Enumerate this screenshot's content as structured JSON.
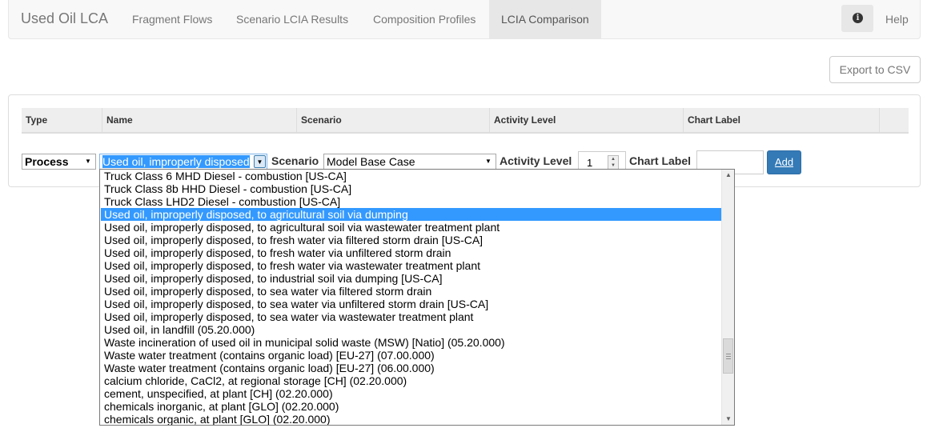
{
  "navbar": {
    "brand": "Used Oil LCA",
    "items": [
      {
        "label": "Fragment Flows"
      },
      {
        "label": "Scenario LCIA Results"
      },
      {
        "label": "Composition Profiles"
      },
      {
        "label": "LCIA Comparison",
        "active": true
      }
    ],
    "info_icon": "info-circle",
    "help_label": "Help"
  },
  "toolbar": {
    "export_label": "Export to CSV"
  },
  "table": {
    "headers": [
      "Type",
      "Name",
      "Scenario",
      "Activity Level",
      "Chart Label"
    ]
  },
  "form": {
    "type_value": "Process",
    "name_value": "Used oil, improperly disposed",
    "scenario_label": "Scenario",
    "scenario_value": "Model Base Case",
    "activity_label": "Activity Level",
    "activity_value": "1",
    "chart_label": "Chart Label",
    "chart_label_value": "",
    "add_label": "Add"
  },
  "dropdown": {
    "highlighted_index": 3,
    "options": [
      "Truck Class 6 MHD Diesel - combustion [US-CA]",
      "Truck Class 8b HHD Diesel - combustion [US-CA]",
      "Truck Class LHD2 Diesel - combustion [US-CA]",
      "Used oil, improperly disposed, to agricultural soil via dumping",
      "Used oil, improperly disposed, to agricultural soil via wastewater treatment plant",
      "Used oil, improperly disposed, to fresh water via filtered storm drain [US-CA]",
      "Used oil, improperly disposed, to fresh water via unfiltered storm drain",
      "Used oil, improperly disposed, to fresh water via wastewater treatment plant",
      "Used oil, improperly disposed, to industrial soil via dumping [US-CA]",
      "Used oil, improperly disposed, to sea water via filtered storm drain",
      "Used oil, improperly disposed, to sea water via unfiltered storm drain [US-CA]",
      "Used oil, improperly disposed, to sea water via wastewater treatment plant",
      "Used oil, in landfill (05.20.000)",
      "Waste incineration of used oil in municipal solid waste (MSW) [Natio] (05.20.000)",
      "Waste water treatment (contains organic load) [EU-27] (07.00.000)",
      "Waste water treatment (contains organic load) [EU-27] (06.00.000)",
      "calcium chloride, CaCl2, at regional storage [CH] (02.20.000)",
      "cement, unspecified, at plant [CH] (02.20.000)",
      "chemicals inorganic, at plant [GLO] (02.20.000)",
      "chemicals organic, at plant [GLO] (02.20.000)"
    ]
  }
}
